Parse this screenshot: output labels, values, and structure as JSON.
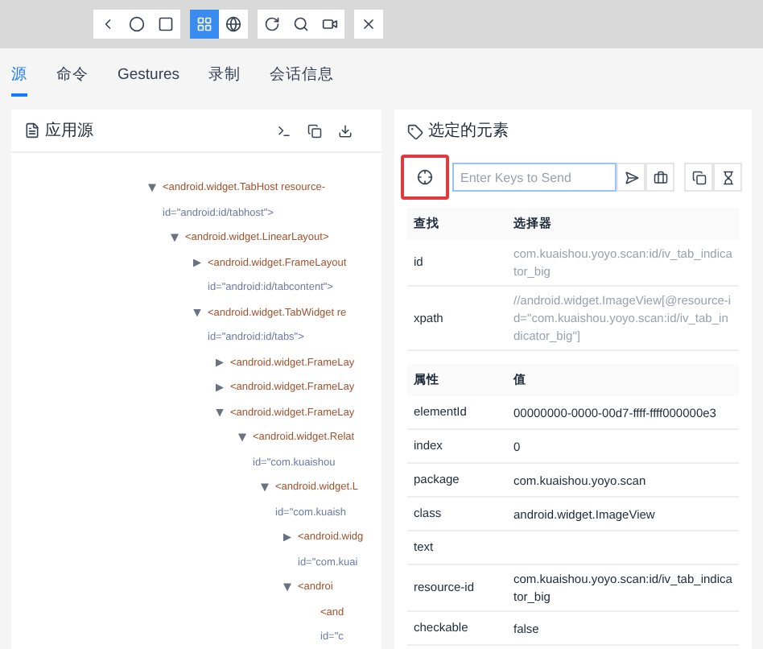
{
  "mode_switch": [
    {
      "selected": true
    },
    {
      "selected": false
    }
  ],
  "tabs": [
    {
      "label": "源",
      "selected": true
    },
    {
      "label": "命令",
      "selected": false
    },
    {
      "label": "Gestures",
      "selected": false
    },
    {
      "label": "录制",
      "selected": false
    },
    {
      "label": "会话信息",
      "selected": false
    }
  ],
  "source_panel": {
    "title": "应用源",
    "tree": [
      {
        "tag": "<android.widget.TabHost resource-",
        "attr": "id=\"android:id/tabhost\">",
        "expanded": true,
        "children": [
          {
            "tag": "<android.widget.LinearLayout>",
            "expanded": true,
            "children": [
              {
                "tag": "<android.widget.FrameLayout",
                "attr": "id=\"android:id/tabcontent\">",
                "expanded": false
              },
              {
                "tag": "<android.widget.TabWidget re",
                "attr": "id=\"android:id/tabs\">",
                "expanded": true,
                "children": [
                  {
                    "tag": "<android.widget.FrameLay",
                    "expanded": false
                  },
                  {
                    "tag": "<android.widget.FrameLay",
                    "expanded": false
                  },
                  {
                    "tag": "<android.widget.FrameLay",
                    "expanded": true,
                    "children": [
                      {
                        "tag": "<android.widget.Relat",
                        "attr": "id=\"com.kuaishou",
                        "expanded": true,
                        "children": [
                          {
                            "tag": "<android.widget.L",
                            "attr": "id=\"com.kuaish",
                            "expanded": true,
                            "children": [
                              {
                                "tag": "<android.widg",
                                "attr": "id=\"com.kuai",
                                "expanded": false
                              },
                              {
                                "tag": "<androi",
                                "expanded": true,
                                "children": [
                                  {
                                    "tag": "<and",
                                    "attr": "id=\"c"
                                  }
                                ]
                              }
                            ]
                          }
                        ]
                      }
                    ]
                  }
                ]
              }
            ]
          }
        ]
      }
    ]
  },
  "selected_element": {
    "title": "选定的元素",
    "keys_placeholder": "Enter Keys to Send",
    "find_table": {
      "columns": [
        "查找",
        "选择器"
      ],
      "rows": [
        [
          "id",
          "com.kuaishou.yoyo.scan:id/iv_tab_indicator_big"
        ],
        [
          "xpath",
          "//android.widget.ImageView[@resource-id=\"com.kuaishou.yoyo.scan:id/iv_tab_indicator_big\"]"
        ]
      ]
    },
    "attr_table": {
      "columns": [
        "属性",
        "值"
      ],
      "rows": [
        [
          "elementId",
          "00000000-0000-00d7-ffff-ffff000000e3"
        ],
        [
          "index",
          "0"
        ],
        [
          "package",
          "com.kuaishou.yoyo.scan"
        ],
        [
          "class",
          "android.widget.ImageView"
        ],
        [
          "text",
          ""
        ],
        [
          "resource-id",
          "com.kuaishou.yoyo.scan:id/iv_tab_indicator_big"
        ],
        [
          "checkable",
          "false"
        ]
      ]
    }
  }
}
